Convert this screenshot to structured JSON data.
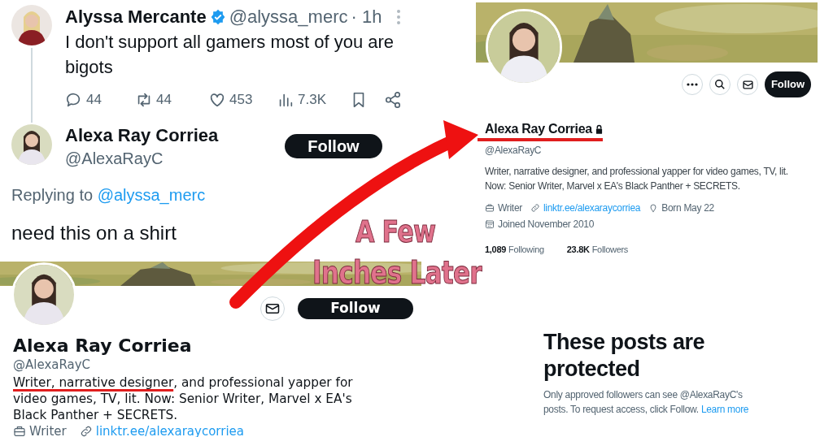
{
  "tweet": {
    "author": "Alyssa Mercante",
    "verified": true,
    "handle": "@alyssa_merc",
    "time": "· 1h",
    "text": "I don't support all gamers most of you are bigots",
    "stats": [
      {
        "kind": "reply",
        "value": "44"
      },
      {
        "kind": "repost",
        "value": "44"
      },
      {
        "kind": "like",
        "value": "453"
      },
      {
        "kind": "views",
        "value": "7.3K"
      },
      {
        "kind": "bookmark"
      },
      {
        "kind": "share"
      }
    ]
  },
  "reply": {
    "author": "Alexa Ray Corriea",
    "handle": "@AlexaRayC",
    "follow": "Follow",
    "replying_prefix": "Replying to",
    "replying_to": "@alyssa_merc",
    "text": "need this on a shirt"
  },
  "profile_mobile": {
    "follow": "Follow",
    "name": "Alexa Ray Corriea",
    "handle": "@AlexaRayC",
    "bio_highlight": "Writer, narrative designer",
    "bio_rest": ", and professional yapper for video games, TV, lit. Now: Senior Writer, Marvel x EA's Black Panther + SECRETS.",
    "meta": [
      {
        "kind": "work",
        "text": "Writer"
      },
      {
        "kind": "link",
        "text": "linktr.ee/alexaraycorriea"
      }
    ]
  },
  "profile_desktop": {
    "follow": "Follow",
    "name": "Alexa Ray Corriea",
    "protected": true,
    "highlighted": true,
    "handle": "@AlexaRayC",
    "bio": "Writer, narrative designer, and professional yapper for video games, TV, lit. Now: Senior Writer, Marvel x EA's Black Panther + SECRETS.",
    "meta": [
      {
        "kind": "work",
        "text": "Writer"
      },
      {
        "kind": "link",
        "text": "linktr.ee/alexaraycorriea"
      },
      {
        "kind": "birthday",
        "text": "Born May 22"
      },
      {
        "kind": "joined",
        "text": "Joined November 2010"
      }
    ],
    "counts": [
      {
        "value": "1,089",
        "label": "Following"
      },
      {
        "value": "23.8K",
        "label": "Followers"
      }
    ]
  },
  "protected_notice": {
    "title": "These posts are protected",
    "text": "Only approved followers can see @AlexaRayC's posts. To request access, click Follow.",
    "link": "Learn more"
  },
  "caption": [
    "A Few",
    "Inches Later"
  ]
}
